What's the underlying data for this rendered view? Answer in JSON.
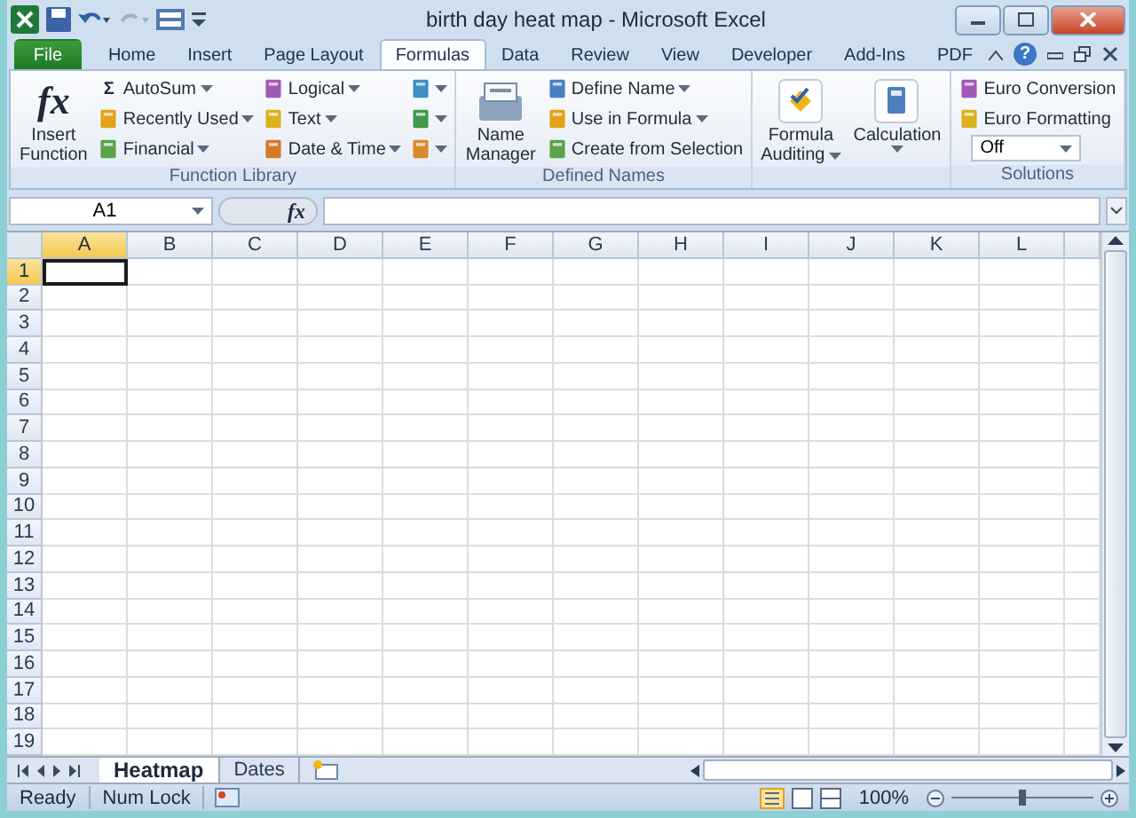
{
  "window": {
    "title": "birth day heat map - Microsoft Excel"
  },
  "ribbon_tabs": [
    {
      "label": "File",
      "kind": "file",
      "selected": false
    },
    {
      "label": "Home",
      "kind": "tab",
      "selected": false
    },
    {
      "label": "Insert",
      "kind": "tab",
      "selected": false
    },
    {
      "label": "Page Layout",
      "kind": "tab",
      "selected": false
    },
    {
      "label": "Formulas",
      "kind": "tab",
      "selected": true
    },
    {
      "label": "Data",
      "kind": "tab",
      "selected": false
    },
    {
      "label": "Review",
      "kind": "tab",
      "selected": false
    },
    {
      "label": "View",
      "kind": "tab",
      "selected": false
    },
    {
      "label": "Developer",
      "kind": "tab",
      "selected": false
    },
    {
      "label": "Add-Ins",
      "kind": "tab",
      "selected": false
    },
    {
      "label": "PDF",
      "kind": "tab",
      "selected": false
    }
  ],
  "help": "?",
  "groups": [
    {
      "label": "Function Library",
      "large": [
        {
          "lines": [
            "Insert",
            "Function"
          ],
          "icon_text": "fx",
          "dropdown": false
        }
      ],
      "columns": [
        [
          {
            "label": "AutoSum",
            "dropdown": true,
            "icon_text": "Σ"
          },
          {
            "label": "Recently Used",
            "dropdown": true
          },
          {
            "label": "Financial",
            "dropdown": true
          }
        ],
        [
          {
            "label": "Logical",
            "dropdown": true
          },
          {
            "label": "Text",
            "dropdown": true
          },
          {
            "label": "Date & Time",
            "dropdown": true
          }
        ],
        [
          {
            "dropdown": true
          },
          {
            "dropdown": true
          },
          {
            "dropdown": true
          }
        ]
      ]
    },
    {
      "label": "Defined Names",
      "large": [
        {
          "lines": [
            "Name",
            "Manager"
          ],
          "dropdown": false
        }
      ],
      "columns": [
        [
          {
            "label": "Define Name",
            "dropdown": true
          },
          {
            "label": "Use in Formula",
            "dropdown": true
          },
          {
            "label": "Create from Selection",
            "dropdown": false
          }
        ]
      ]
    },
    {
      "large": [
        {
          "lines": [
            "Formula",
            "Auditing"
          ],
          "dropdown": true
        },
        {
          "lines": [
            "Calculation"
          ],
          "dropdown": true
        }
      ]
    },
    {
      "label": "Solutions",
      "columns": [
        [
          {
            "label": "Euro Conversion",
            "dropdown": false
          },
          {
            "label": "Euro Formatting",
            "dropdown": false
          },
          {
            "kind": "select",
            "value": "Off",
            "dropdown": true
          }
        ]
      ]
    }
  ],
  "formula_bar": {
    "name_box": "A1",
    "fx": "fx"
  },
  "columns": [
    {
      "label": "A",
      "selected": true
    },
    {
      "label": "B",
      "selected": false
    },
    {
      "label": "C",
      "selected": false
    },
    {
      "label": "D",
      "selected": false
    },
    {
      "label": "E",
      "selected": false
    },
    {
      "label": "F",
      "selected": false
    },
    {
      "label": "G",
      "selected": false
    },
    {
      "label": "H",
      "selected": false
    },
    {
      "label": "I",
      "selected": false
    },
    {
      "label": "J",
      "selected": false
    },
    {
      "label": "K",
      "selected": false
    },
    {
      "label": "L",
      "selected": false
    }
  ],
  "rows": [
    {
      "label": "1",
      "selected": true
    },
    {
      "label": "2",
      "selected": false
    },
    {
      "label": "3",
      "selected": false
    },
    {
      "label": "4",
      "selected": false
    },
    {
      "label": "5",
      "selected": false
    },
    {
      "label": "6",
      "selected": false
    },
    {
      "label": "7",
      "selected": false
    },
    {
      "label": "8",
      "selected": false
    },
    {
      "label": "9",
      "selected": false
    },
    {
      "label": "10",
      "selected": false
    },
    {
      "label": "11",
      "selected": false
    },
    {
      "label": "12",
      "selected": false
    },
    {
      "label": "13",
      "selected": false
    },
    {
      "label": "14",
      "selected": false
    },
    {
      "label": "15",
      "selected": false
    },
    {
      "label": "16",
      "selected": false
    },
    {
      "label": "17",
      "selected": false
    },
    {
      "label": "18",
      "selected": false
    },
    {
      "label": "19",
      "selected": false
    }
  ],
  "sheets": [
    {
      "label": "Heatmap",
      "selected": true
    },
    {
      "label": "Dates",
      "selected": false
    }
  ],
  "status_bar": {
    "items": [
      "Ready",
      "Num Lock"
    ],
    "zoom": "100%",
    "zoom_slider": {
      "level": 0.5
    }
  }
}
